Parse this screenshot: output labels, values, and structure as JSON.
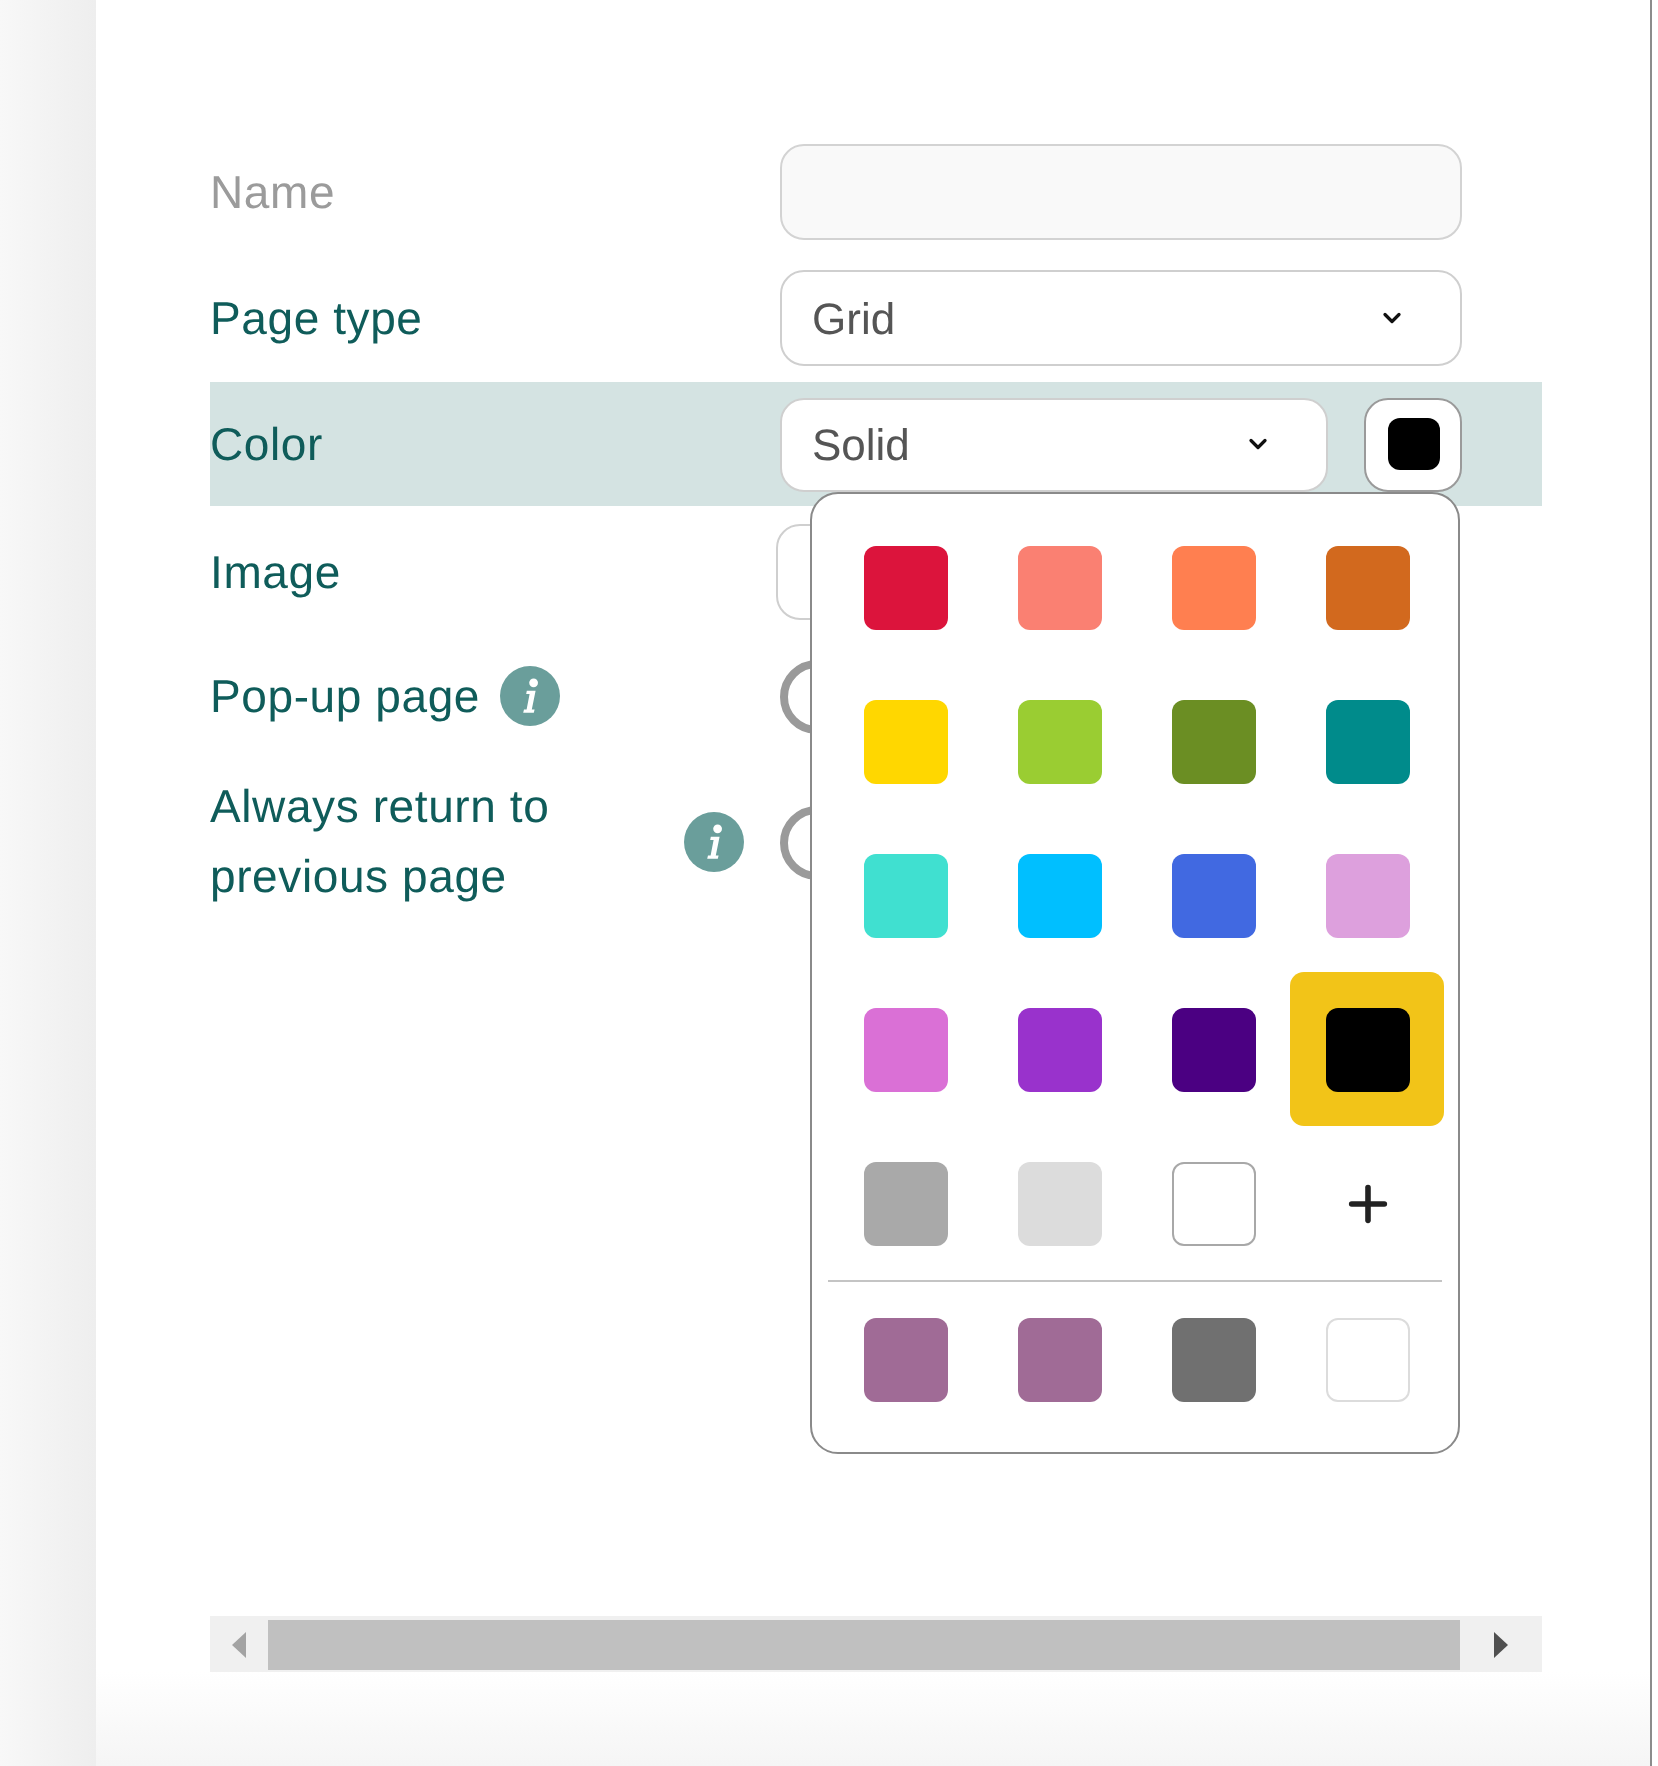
{
  "form": {
    "rows": [
      {
        "kind": "text",
        "label": "Name",
        "disabled": true,
        "highlighted": false
      },
      {
        "kind": "select",
        "label": "Page type",
        "value": "Grid",
        "disabled": false,
        "highlighted": false
      },
      {
        "kind": "color",
        "label": "Color",
        "value": "Solid",
        "color": "#000000",
        "disabled": false,
        "highlighted": true
      },
      {
        "kind": "image",
        "label": "Image",
        "disabled": false,
        "highlighted": false
      },
      {
        "kind": "radio",
        "label": "Pop-up page",
        "info": true,
        "checked": false,
        "disabled": false,
        "highlighted": false
      },
      {
        "kind": "radio",
        "label": "Always return to previous page",
        "info": true,
        "checked": false,
        "disabled": false,
        "highlighted": false
      }
    ]
  },
  "color_picker": {
    "swatches": [
      {
        "color": "#dc143c",
        "selected": false
      },
      {
        "color": "#fa8072",
        "selected": false
      },
      {
        "color": "#ff7f50",
        "selected": false
      },
      {
        "color": "#d2691e",
        "selected": false
      },
      {
        "color": "#ffd700",
        "selected": false
      },
      {
        "color": "#9acd32",
        "selected": false
      },
      {
        "color": "#6b8e23",
        "selected": false
      },
      {
        "color": "#008b8b",
        "selected": false
      },
      {
        "color": "#40e0d0",
        "selected": false
      },
      {
        "color": "#00bfff",
        "selected": false
      },
      {
        "color": "#4169e1",
        "selected": false
      },
      {
        "color": "#dda0dd",
        "selected": false
      },
      {
        "color": "#da70d6",
        "selected": false
      },
      {
        "color": "#9932cc",
        "selected": false
      },
      {
        "color": "#4b0082",
        "selected": false
      },
      {
        "color": "#000000",
        "selected": true
      },
      {
        "color": "#a9a9a9",
        "selected": false
      },
      {
        "color": "#dcdcdc",
        "selected": false
      },
      {
        "color": "#ffffff",
        "selected": false
      }
    ],
    "recent": [
      {
        "color": "#a06b96",
        "selected": false
      },
      {
        "color": "#a06b96",
        "selected": false
      },
      {
        "color": "#707070",
        "selected": false
      },
      {
        "color": "#ffffff",
        "selected": false
      }
    ]
  }
}
